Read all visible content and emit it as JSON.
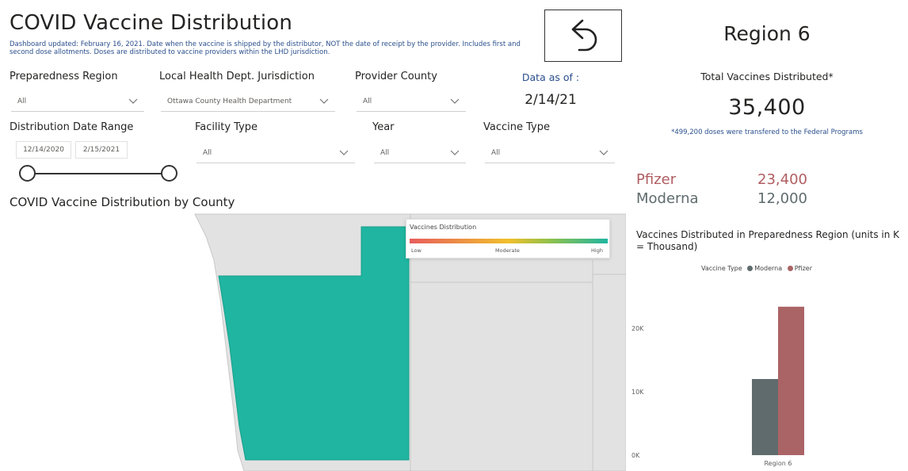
{
  "header": {
    "title": "COVID Vaccine Distribution",
    "subtitle": "Dashboard updated: February 16, 2021. Date when the vaccine is shipped by the distributor, NOT the date of receipt by the provider. Includes first and second dose allotments. Doses are distributed to vaccine providers within the LHD jurisdiction.",
    "back_icon": "back-arrow-icon",
    "region_title": "Region 6"
  },
  "slicers": {
    "preparedness_region": {
      "label": "Preparedness Region",
      "value": "All"
    },
    "lhd_jurisdiction": {
      "label": "Local Health Dept. Jurisdiction",
      "value": "Ottawa County Health Department"
    },
    "provider_county": {
      "label": "Provider County",
      "value": "All"
    },
    "data_as_of": {
      "label": "Data as of :",
      "value": "2/14/21"
    },
    "date_range": {
      "label": "Distribution Date Range",
      "start": "12/14/2020",
      "end": "2/15/2021"
    },
    "facility_type": {
      "label": "Facility Type",
      "value": "All"
    },
    "year": {
      "label": "Year",
      "value": "All"
    },
    "vaccine_type": {
      "label": "Vaccine Type",
      "value": "All"
    }
  },
  "map": {
    "title": "COVID Vaccine Distribution by County",
    "legend": {
      "title": "Vaccines Distribution",
      "low": "Low",
      "moderate": "Moderate",
      "high": "High"
    },
    "highlight_color": "#1fb5a0"
  },
  "totals": {
    "label": "Total Vaccines Distributed*",
    "value": "35,400",
    "note": "*499,200 doses were transfered to the Federal Programs",
    "by_type": [
      {
        "name": "Pfizer",
        "value": "23,400",
        "color": "#b05d62"
      },
      {
        "name": "Moderna",
        "value": "12,000",
        "color": "#5f6b6d"
      }
    ]
  },
  "chart_data": {
    "type": "bar",
    "title": "Vaccines Distributed in Preparedness Region (units in K = Thousand)",
    "legend_title": "Vaccine Type",
    "categories": [
      "Region 6"
    ],
    "series": [
      {
        "name": "Moderna",
        "values": [
          12000
        ],
        "color": "#5f6b6d"
      },
      {
        "name": "Pfizer",
        "values": [
          23400
        ],
        "color": "#ab6466"
      }
    ],
    "y_ticks": [
      "0K",
      "10K",
      "20K"
    ],
    "ylim": [
      0,
      26000
    ]
  }
}
